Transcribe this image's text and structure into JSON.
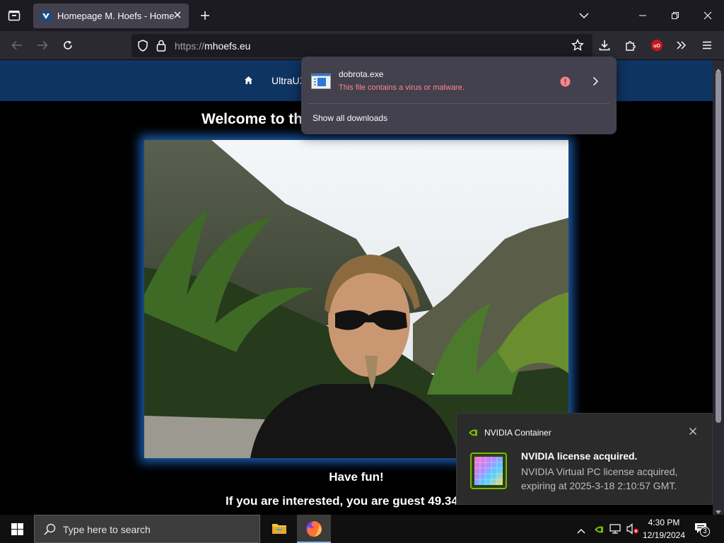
{
  "browser": {
    "tab_title": "Homepage M. Hoefs - Home",
    "url_scheme": "https://",
    "url_host": "mhoefs.eu"
  },
  "site": {
    "nav_label": "UltraUX",
    "welcome": "Welcome to th",
    "have_fun": "Have fun!",
    "guest_text": "If you are interested, you are guest 49.34"
  },
  "downloads": {
    "file_name": "dobrota.exe",
    "status": "This file contains a virus or malware.",
    "show_all": "Show all downloads"
  },
  "notification": {
    "app_name": "NVIDIA Container",
    "title": "NVIDIA license acquired.",
    "body": "NVIDIA Virtual PC license acquired, expiring at 2025-3-18 2:10:57 GMT."
  },
  "taskbar": {
    "search_placeholder": "Type here to search",
    "time": "4:30 PM",
    "date": "12/19/2024",
    "notification_count": "3"
  },
  "colors": {
    "site_header": "#0e3462",
    "photo_glow": "#1b5eb0",
    "malware_text": "#ff848b"
  }
}
